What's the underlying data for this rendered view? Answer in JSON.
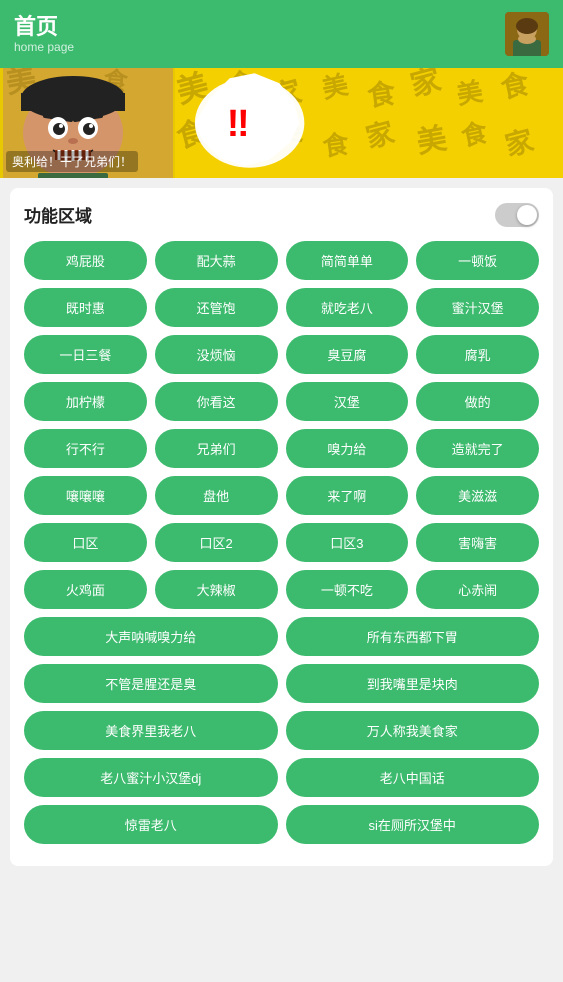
{
  "header": {
    "title": "首页",
    "subtitle": "home page"
  },
  "banner": {
    "caption": "奥利给！干了兄弟们！",
    "bg_chars": [
      "美",
      "食",
      "家",
      "美",
      "食",
      "家",
      "美",
      "食",
      "家",
      "美",
      "食",
      "家",
      "美",
      "食",
      "家",
      "美",
      "食",
      "家"
    ],
    "exclaim": "‼"
  },
  "section": {
    "title": "功能区域"
  },
  "buttons_row1": [
    "鸡屁股",
    "配大蒜",
    "简简单单",
    "一顿饭"
  ],
  "buttons_row2": [
    "既时惠",
    "还管饱",
    "就吃老八",
    "蜜汁汉堡"
  ],
  "buttons_row3": [
    "一日三餐",
    "没烦恼",
    "臭豆腐",
    "腐乳"
  ],
  "buttons_row4": [
    "加柠檬",
    "你看这",
    "汉堡",
    "做的"
  ],
  "buttons_row5": [
    "行不行",
    "兄弟们",
    "嗅力给",
    "造就完了"
  ],
  "buttons_row6": [
    "嚷嚷嚷",
    "盘他",
    "来了啊",
    "美滋滋"
  ],
  "buttons_row7": [
    "口区",
    "口区2",
    "口区3",
    "害嗨害"
  ],
  "buttons_row8": [
    "火鸡面",
    "大辣椒",
    "一顿不吃",
    "心赤闹"
  ],
  "buttons_wide_row1": [
    "大声呐喊嗅力给",
    "所有东西都下胃"
  ],
  "buttons_wide_row2": [
    "不管是腥还是臭",
    "到我嘴里是块肉"
  ],
  "buttons_wide_row3": [
    "美食界里我老八",
    "万人称我美食家"
  ],
  "buttons_wide_row4": [
    "老八蜜汁小汉堡dj",
    "老八中国话"
  ],
  "buttons_wide_row5": [
    "惊雷老八",
    "si在厕所汉堡中"
  ]
}
